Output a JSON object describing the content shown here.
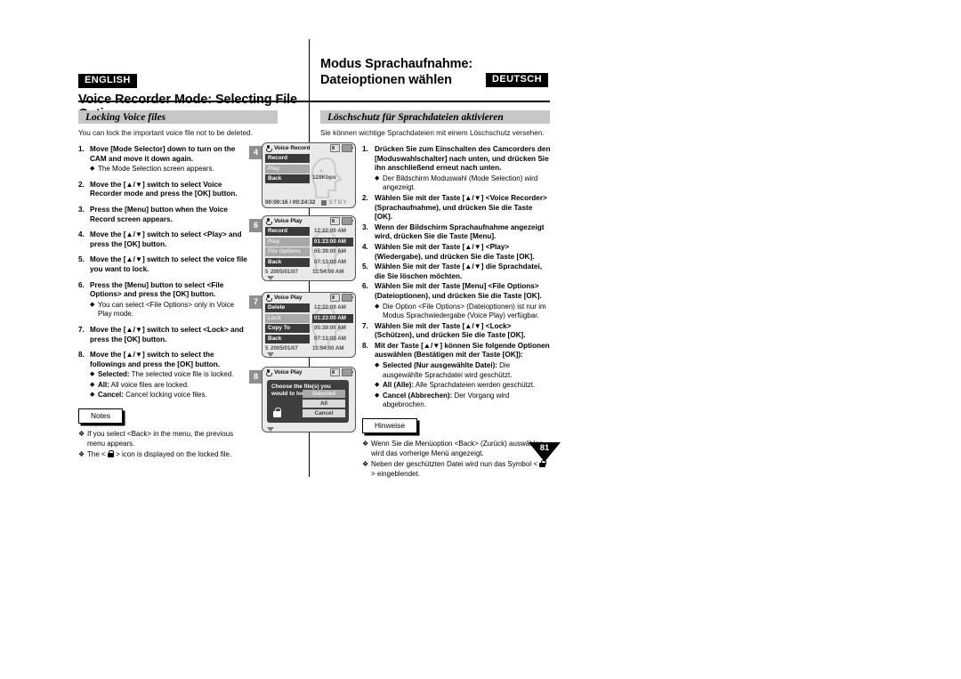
{
  "header": {
    "english_tag": "ENGLISH",
    "deutsch_tag": "DEUTSCH",
    "english_title": "Voice Recorder Mode: Selecting File Options",
    "german_title_line1": "Modus Sprachaufnahme:",
    "german_title_line2": "Dateioptionen wählen"
  },
  "sections": {
    "english_heading": "Locking Voice files",
    "german_heading": "Löschschutz für Sprachdateien aktivieren",
    "english_intro": "You can lock the important voice file not to be deleted.",
    "german_intro": "Sie können wichtige Sprachdateien mit einem Löschschutz versehen."
  },
  "english_steps": [
    {
      "num": "1.",
      "text": "Move [Mode Selector] down to turn on the CAM and move it down again.",
      "bullets": [
        "The Mode Selection screen appears."
      ]
    },
    {
      "num": "2.",
      "text": "Move the [▲/▼] switch to select Voice Recorder mode and press the [OK] button.",
      "bullets": []
    },
    {
      "num": "3.",
      "text": "Press the [Menu] button when the Voice Record screen appears.",
      "bullets": []
    },
    {
      "num": "4.",
      "text": "Move the [▲/▼] switch to select <Play> and press the [OK] button.",
      "bullets": []
    },
    {
      "num": "5.",
      "text": "Move the [▲/▼] switch to select the voice file you want to lock.",
      "bullets": []
    },
    {
      "num": "6.",
      "text": "Press the [Menu] button to select <File Options> and press the [OK] button.",
      "bullets": [
        "You can select <File Options> only in Voice Play mode."
      ]
    },
    {
      "num": "7.",
      "text": "Move the [▲/▼] switch to select <Lock> and press the [OK] button.",
      "bullets": []
    },
    {
      "num": "8.",
      "text": "Move the [▲/▼] switch to select the followings and press the [OK] button.",
      "bullets": [
        "Selected: The selected voice file is locked.",
        "All: All voice files are locked.",
        "Cancel: Cancel locking voice files."
      ]
    }
  ],
  "german_steps": [
    {
      "num": "1.",
      "text": "Drücken Sie zum Einschalten des Camcorders den [Moduswahlschalter] nach unten, und drücken Sie ihn anschließend erneut nach unten.",
      "bullets": [
        "Der Bildschirm Moduswahl (Mode Selection) wird angezeigt."
      ]
    },
    {
      "num": "2.",
      "text": "Wählen Sie mit der Taste [▲/▼] <Voice Recorder> (Sprachaufnahme), und drücken Sie die Taste [OK].",
      "bullets": []
    },
    {
      "num": "3.",
      "text": "Wenn der Bildschirm Sprachaufnahme angezeigt wird, drücken Sie die Taste [Menu].",
      "bullets": []
    },
    {
      "num": "4.",
      "text": "Wählen Sie mit der Taste [▲/▼] <Play> (Wiedergabe), und drücken Sie die Taste [OK].",
      "bullets": []
    },
    {
      "num": "5.",
      "text": "Wählen Sie mit der Taste [▲/▼] die Sprachdatei, die Sie löschen möchten.",
      "bullets": []
    },
    {
      "num": "6.",
      "text": "Wählen Sie mit der Taste [Menu] <File Options> (Dateioptionen), und drücken Sie die Taste [OK].",
      "bullets": [
        "Die Option <File Options> (Dateioptionen) ist nur im Modus Sprachwiedergabe (Voice Play) verfügbar."
      ]
    },
    {
      "num": "7.",
      "text": "Wählen Sie mit der Taste [▲/▼] <Lock> (Schützen), und drücken Sie die Taste [OK].",
      "bullets": []
    },
    {
      "num": "8.",
      "text": "Mit der Taste [▲/▼] können Sie folgende Optionen auswählen (Bestätigen mit der Taste [OK]):",
      "bullets": [
        "Selected (Nur ausgewählte Datei): Die ausgewählte Sprachdatei wird geschützt.",
        "All (Alle): Alle Sprachdateien werden geschützt.",
        "Cancel (Abbrechen): Der Vorgang wird abgebrochen."
      ]
    }
  ],
  "notes_en": {
    "label": "Notes",
    "items": [
      "If you select <Back> in the menu, the previous menu appears.",
      "The <  > icon is displayed on the locked file."
    ]
  },
  "notes_de": {
    "label": "Hinweise",
    "items": [
      "Wenn Sie die Menüoption <Back> (Zurück) auswählen, wird das vorherige Menü angezeigt.",
      "Neben der geschützten Datei wird nun das Symbol <  > eingeblendet."
    ]
  },
  "screens": [
    {
      "badge": "4",
      "title": "Voice Record",
      "menu": [
        {
          "label": "Record",
          "selected": false
        },
        {
          "label": "Play",
          "selected": true
        },
        {
          "label": "Back",
          "selected": false
        }
      ],
      "bitrate": "128Kbps",
      "timecode": "00:00:16 / 00:24:32",
      "status": "STBY"
    },
    {
      "badge": "6",
      "title": "Voice Play",
      "menu": [
        {
          "label": "Record",
          "selected": false
        },
        {
          "label": "Play",
          "selected": true
        },
        {
          "label": "File Options",
          "selected": true
        },
        {
          "label": "Back",
          "selected": false
        }
      ],
      "files": [
        {
          "time": "12:22:00 AM",
          "selected": false
        },
        {
          "time": "01:23:00 AM",
          "selected": true
        },
        {
          "time": "05:39:00 AM",
          "selected": false
        },
        {
          "time": "07:13:00 AM",
          "selected": false
        }
      ],
      "last_row": {
        "index": "5",
        "date": "2005/01/07",
        "time": "11:54:00 AM"
      }
    },
    {
      "badge": "7",
      "title": "Voice Play",
      "menu": [
        {
          "label": "Delete",
          "selected": false
        },
        {
          "label": "Lock",
          "selected": true
        },
        {
          "label": "Copy To",
          "selected": false
        },
        {
          "label": "Back",
          "selected": false
        }
      ],
      "files": [
        {
          "time": "12:22:00 AM",
          "selected": false
        },
        {
          "time": "01:23:00 AM",
          "selected": true
        },
        {
          "time": "05:39:00 AM",
          "selected": false
        },
        {
          "time": "07:13:00 AM",
          "selected": false
        }
      ],
      "last_row": {
        "index": "5",
        "date": "2005/01/07",
        "time": "11:54:00 AM"
      }
    },
    {
      "badge": "8",
      "title": "Voice Play",
      "dialog_text": "Choose the file(s) you would to lock.",
      "options": [
        {
          "label": "Selected",
          "highlighted": true
        },
        {
          "label": "All",
          "highlighted": false
        },
        {
          "label": "Cancel",
          "highlighted": false
        }
      ]
    }
  ],
  "page_number": "81",
  "colors": {
    "section_bar": "#c6c6c6",
    "badge": "#8f8f8f",
    "lcd_bg": "#e9e9e9",
    "menu_item": "#3a3a3a",
    "menu_selected": "#a8a8a8"
  }
}
